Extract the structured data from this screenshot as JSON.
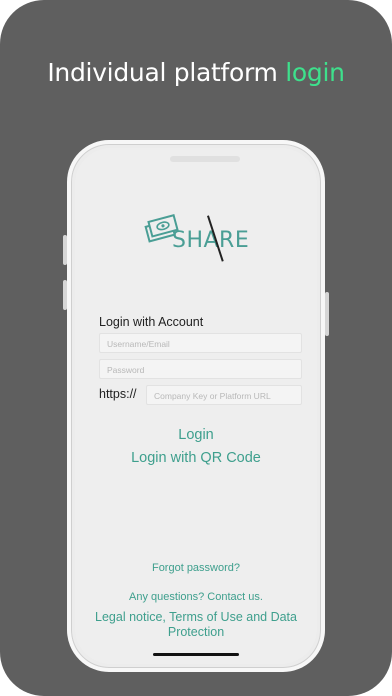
{
  "headline": {
    "prefix": "Individual platform ",
    "accent": "login"
  },
  "brand": {
    "logo_text": "SHARE"
  },
  "form": {
    "title": "Login with Account",
    "username_placeholder": "Username/Email",
    "password_placeholder": "Password",
    "url_prefix": "https://",
    "url_placeholder": "Company Key or Platform URL"
  },
  "actions": {
    "login": "Login",
    "login_qr": "Login with QR Code",
    "forgot": "Forgot password?",
    "questions": "Any questions? Contact us.",
    "legal": "Legal notice, Terms of Use and Data Protection"
  },
  "colors": {
    "accent_headline": "#3ee08c",
    "accent_link": "#3e9f8d",
    "card_bg": "#5f5f5f"
  }
}
